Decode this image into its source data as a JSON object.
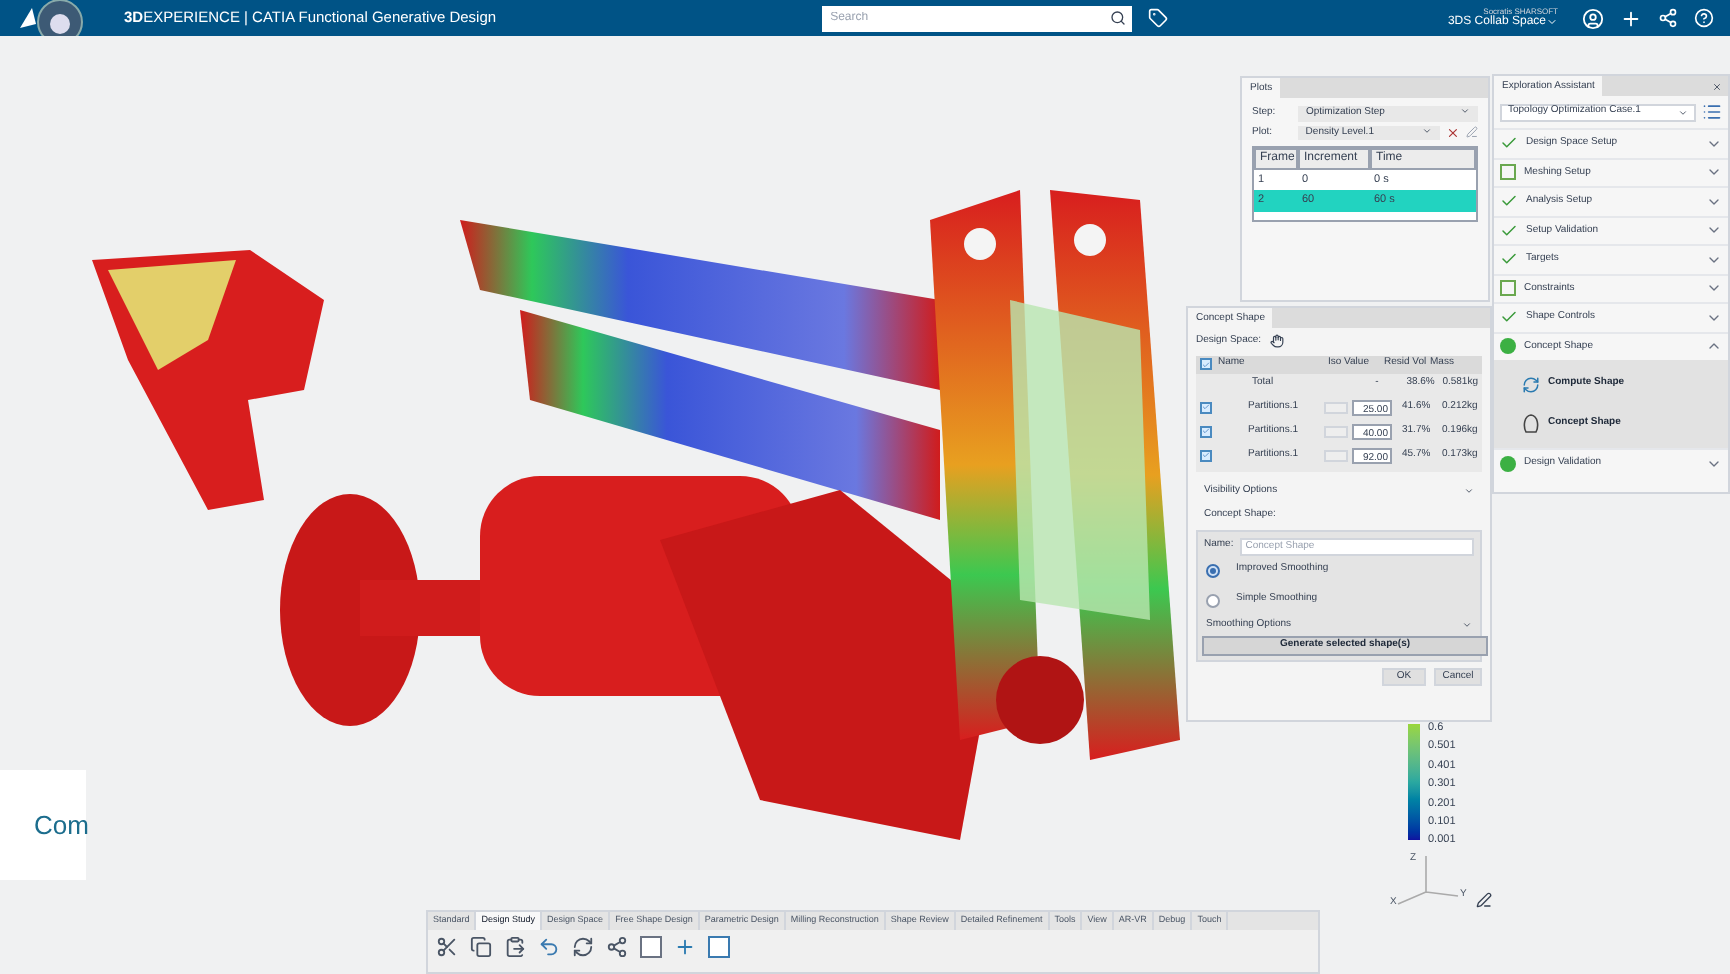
{
  "top_bar": {
    "title": "**3D**EXPERIENCE | CATIA Functional Generative Design",
    "search": {
      "placeholder": "Search"
    },
    "user": "Socratis SHARSOFT",
    "space": "3DS Collab Space"
  },
  "plots": {
    "title": "Plots",
    "step_label": "Step:",
    "step_value": "Optimization Step",
    "plot_label": "Plot:",
    "plot_value": "Density Level.1",
    "columns": [
      "Frame",
      "Increment",
      "Time"
    ],
    "rows": [
      {
        "cells": [
          "1",
          "0",
          "0 s"
        ],
        "selected": false
      },
      {
        "cells": [
          "2",
          "60",
          "60 s"
        ],
        "selected": true
      }
    ]
  },
  "concept_panel": {
    "title": "Concept Shape",
    "design_space_label": "Design Space:",
    "all_checked": true,
    "columns": [
      "Name",
      "Iso Value",
      "Resid Vol",
      "Mass"
    ],
    "total": {
      "name": "Total",
      "iso": "-",
      "vol": "38.6%",
      "mass": "0.581kg"
    },
    "rows": [
      {
        "checked": true,
        "name": "Partitions.1",
        "iso": "25.00",
        "vol": "41.6%",
        "mass": "0.212kg"
      },
      {
        "checked": true,
        "name": "Partitions.1",
        "iso": "40.00",
        "vol": "31.7%",
        "mass": "0.196kg"
      },
      {
        "checked": true,
        "name": "Partitions.1",
        "iso": "92.00",
        "vol": "45.7%",
        "mass": "0.173kg"
      }
    ],
    "visibility": "Visibility Options",
    "concept_label": "Concept Shape:",
    "name_label": "Name:",
    "name_placeholder": "Concept Shape",
    "options": [
      {
        "label": "Improved Smoothing",
        "selected": true
      },
      {
        "label": "Simple Smoothing",
        "selected": false
      }
    ],
    "smoothing": "Smoothing Options",
    "generate": "Generate selected shape(s)",
    "ok": "OK",
    "cancel": "Cancel"
  },
  "assistant": {
    "title": "Exploration Assistant",
    "case": "Topology Optimization Case.1",
    "steps": [
      {
        "label": "Design Space Setup",
        "kind": "done",
        "expanded": false
      },
      {
        "label": "Meshing Setup",
        "kind": "todo",
        "expanded": false
      },
      {
        "label": "Analysis Setup",
        "kind": "done",
        "expanded": false
      },
      {
        "label": "Setup Validation",
        "kind": "done",
        "expanded": false
      },
      {
        "label": "Targets",
        "kind": "done",
        "expanded": false
      },
      {
        "label": "Constraints",
        "kind": "todo",
        "expanded": false
      },
      {
        "label": "Shape Controls",
        "kind": "done",
        "expanded": false
      },
      {
        "label": "Concept Shape",
        "kind": "active",
        "expanded": true,
        "actions": [
          {
            "label": "Compute Shape",
            "kind": "compute"
          },
          {
            "label": "Concept Shape",
            "kind": "shape"
          }
        ]
      },
      {
        "label": "Design Validation",
        "kind": "active",
        "expanded": false
      }
    ]
  },
  "legend": {
    "values": [
      "0.6",
      "0.501",
      "0.401",
      "0.301",
      "0.201",
      "0.101",
      "0.001"
    ],
    "axes": [
      "Z",
      "X",
      "Y"
    ]
  },
  "side_text": "Com",
  "toolbar": {
    "tabs": [
      {
        "label": "Standard",
        "selected": false
      },
      {
        "label": "Design Study",
        "selected": true
      },
      {
        "label": "Design Space",
        "selected": false
      },
      {
        "label": "Free Shape Design",
        "selected": false
      },
      {
        "label": "Parametric Design",
        "selected": false
      },
      {
        "label": "Milling Reconstruction",
        "selected": false
      },
      {
        "label": "Shape Review",
        "selected": false
      },
      {
        "label": "Detailed Refinement",
        "selected": false
      },
      {
        "label": "Tools",
        "selected": false
      },
      {
        "label": "View",
        "selected": false
      },
      {
        "label": "AR-VR",
        "selected": false
      },
      {
        "label": "Debug",
        "selected": false
      },
      {
        "label": "Touch",
        "selected": false
      }
    ]
  }
}
